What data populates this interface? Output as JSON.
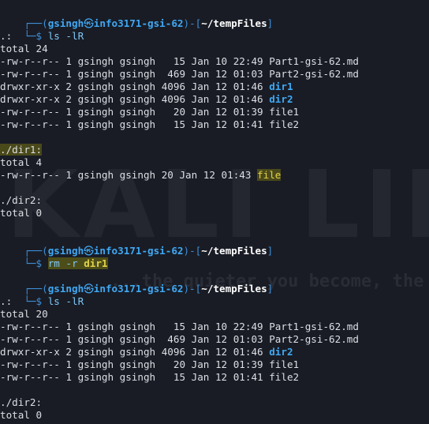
{
  "prompt": {
    "user": "gsingh",
    "skull": "㉿",
    "host": "info3171-gsi-62",
    "cwd": "~/tempFiles"
  },
  "block1": {
    "command": "ls -lR",
    "dot": ".:",
    "total": "total 24",
    "rows": [
      {
        "meta": "-rw-r--r-- 1 gsingh gsingh   15 Jan 10 22:49 ",
        "name": "Part1-gsi-62.md"
      },
      {
        "meta": "-rw-r--r-- 1 gsingh gsingh  469 Jan 12 01:03 ",
        "name": "Part2-gsi-62.md"
      },
      {
        "meta": "drwxr-xr-x 2 gsingh gsingh 4096 Jan 12 01:46 ",
        "name": "dir1"
      },
      {
        "meta": "drwxr-xr-x 2 gsingh gsingh 4096 Jan 12 01:46 ",
        "name": "dir2"
      },
      {
        "meta": "-rw-r--r-- 1 gsingh gsingh   20 Jan 12 01:39 ",
        "name": "file1"
      },
      {
        "meta": "-rw-r--r-- 1 gsingh gsingh   15 Jan 12 01:41 ",
        "name": "file2"
      }
    ],
    "dir1_header": "./dir1:",
    "dir1_total": "total 4",
    "dir1_row": {
      "meta": "-rw-r--r-- 1 gsingh gsingh 20 Jan 12 01:43 ",
      "name": "file"
    },
    "dir2_header": "./dir2:",
    "dir2_total": "total 0"
  },
  "block2": {
    "command_word": "rm -r ",
    "command_arg": "dir1"
  },
  "block3": {
    "command": "ls -lR",
    "dot": ".:",
    "total": "total 20",
    "rows": [
      {
        "meta": "-rw-r--r-- 1 gsingh gsingh   15 Jan 10 22:49 ",
        "name": "Part1-gsi-62.md"
      },
      {
        "meta": "-rw-r--r-- 1 gsingh gsingh  469 Jan 12 01:03 ",
        "name": "Part2-gsi-62.md"
      },
      {
        "meta": "drwxr-xr-x 2 gsingh gsingh 4096 Jan 12 01:46 ",
        "name": "dir2"
      },
      {
        "meta": "-rw-r--r-- 1 gsingh gsingh   20 Jan 12 01:39 ",
        "name": "file1"
      },
      {
        "meta": "-rw-r--r-- 1 gsingh gsingh   15 Jan 12 01:41 ",
        "name": "file2"
      }
    ],
    "dir2_header": "./dir2:",
    "dir2_total": "total 0"
  },
  "watermark": {
    "logo": "KALI LINUX",
    "tagline": "...the quieter you become, the more you"
  },
  "colors": {
    "background": "#191c25",
    "prompt_frame": "#3f8fd8",
    "directory": "#3fa9f5",
    "highlight": "#e2d34a"
  }
}
